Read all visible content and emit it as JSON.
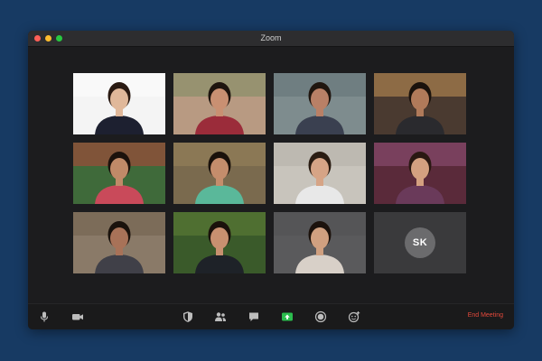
{
  "window": {
    "title": "Zoom"
  },
  "participants": [
    {
      "id": "p1",
      "bg": "#f4f4f4",
      "skin": "#e0b89a",
      "hair": "#2a1a12",
      "shirt": "#1d2030",
      "bgAccent": "#ffffff"
    },
    {
      "id": "p2",
      "bg": "#b89a82",
      "skin": "#c99072",
      "hair": "#1e140e",
      "shirt": "#9b2c3a",
      "bgAccent": "#6f8a5a"
    },
    {
      "id": "p3",
      "bg": "#7e8c8e",
      "skin": "#b98066",
      "hair": "#20160f",
      "shirt": "#3a4050",
      "bgAccent": "#5d6c70"
    },
    {
      "id": "p4",
      "bg": "#4a3a30",
      "skin": "#b07a5a",
      "hair": "#1a120c",
      "shirt": "#2a2a2e",
      "bgAccent": "#e0a860"
    },
    {
      "id": "p5",
      "bg": "#3f6a3a",
      "skin": "#c08a68",
      "hair": "#1c120c",
      "shirt": "#c94a5a",
      "bgAccent": "#d13a3a"
    },
    {
      "id": "p6",
      "bg": "#7a6a4e",
      "skin": "#c48d6c",
      "hair": "#1a110b",
      "shirt": "#5ab89a",
      "bgAccent": "#a08a60"
    },
    {
      "id": "p7",
      "bg": "#c8c4bc",
      "skin": "#d6a486",
      "hair": "#2a1c12",
      "shirt": "#e8e8e8",
      "bgAccent": "#b0aca4"
    },
    {
      "id": "p8",
      "bg": "#5a2a3a",
      "skin": "#d4a080",
      "hair": "#2a1812",
      "shirt": "#6a3a5a",
      "bgAccent": "#a05a8a"
    },
    {
      "id": "p9",
      "bg": "#8a7a68",
      "skin": "#a87258",
      "hair": "#1a120c",
      "shirt": "#404048",
      "bgAccent": "#6a5a48"
    },
    {
      "id": "p10",
      "bg": "#3a5a2a",
      "skin": "#c89070",
      "hair": "#1a110b",
      "shirt": "#1e2228",
      "bgAccent": "#6a8a3a"
    },
    {
      "id": "p11",
      "bg": "#5a5a5c",
      "skin": "#d0a080",
      "hair": "#1c120c",
      "shirt": "#d8d0c8",
      "bgAccent": "#505052"
    },
    {
      "id": "p12",
      "initials": "SK"
    }
  ],
  "toolbar": {
    "end_meeting_label": "End Meeting"
  },
  "colors": {
    "end_meeting": "#e5493b",
    "share_accent": "#2bbd4e",
    "window_bg": "#1c1c1e",
    "desktop_bg": "#173a63"
  }
}
